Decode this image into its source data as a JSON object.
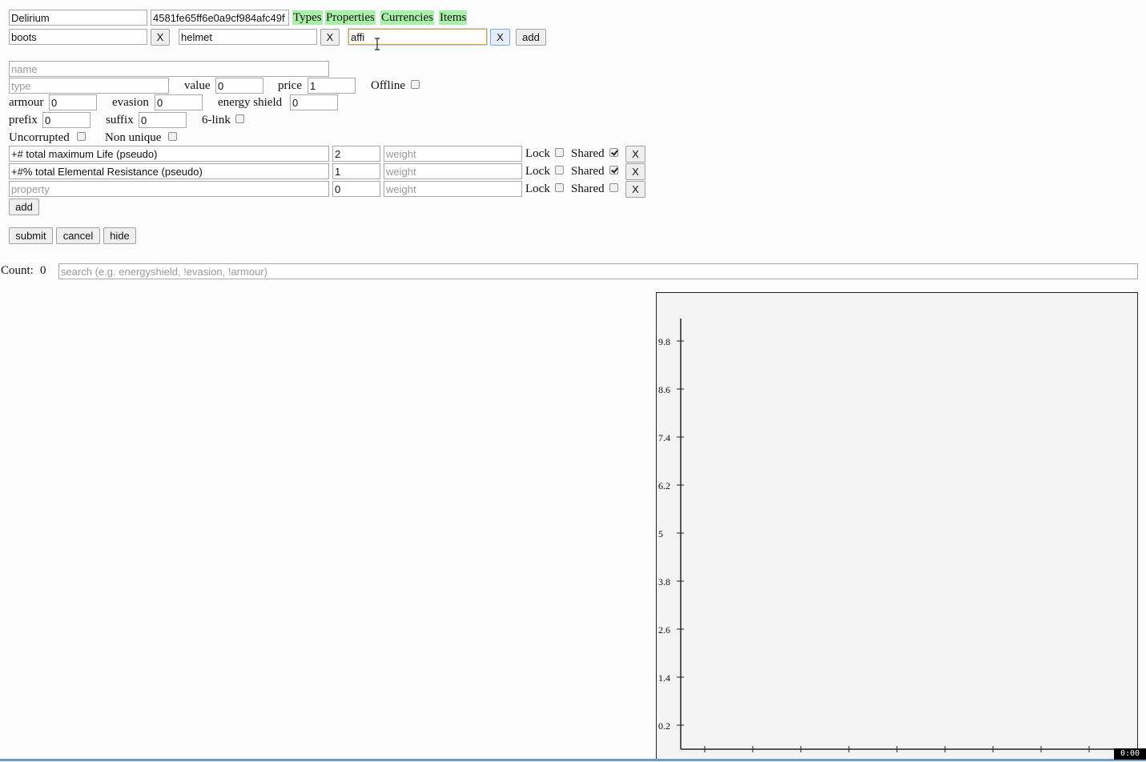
{
  "league": {
    "name_value": "Delirium",
    "id_value": "4581fe65ff6e0a9cf984afc49f"
  },
  "nav_links": [
    "Types",
    "Properties",
    "Currencies",
    "Items"
  ],
  "filters": [
    {
      "value": "boots",
      "remove_label": "X"
    },
    {
      "value": "helmet",
      "remove_label": "X"
    },
    {
      "value": "affi",
      "remove_label": "X"
    }
  ],
  "filter_add_label": "add",
  "form": {
    "name_placeholder": "name",
    "type_placeholder": "type",
    "value_label": "value",
    "value_value": "0",
    "price_label": "price",
    "price_value": "1",
    "offline_label": "Offline",
    "armour_label": "armour",
    "armour_value": "0",
    "evasion_label": "evasion",
    "evasion_value": "0",
    "energy_shield_label": "energy shield",
    "energy_shield_value": "0",
    "prefix_label": "prefix",
    "prefix_value": "0",
    "suffix_label": "suffix",
    "suffix_value": "0",
    "six_link_label": "6-link",
    "uncorrupted_label": "Uncorrupted",
    "non_unique_label": "Non unique"
  },
  "properties": [
    {
      "name": "+# total maximum Life (pseudo)",
      "weight_value": "2",
      "weight_placeholder": "weight",
      "lock": false,
      "shared": true
    },
    {
      "name": "+#% total Elemental Resistance (pseudo)",
      "weight_value": "1",
      "weight_placeholder": "weight",
      "lock": false,
      "shared": true
    },
    {
      "name": "",
      "placeholder": "property",
      "weight_value": "0",
      "weight_placeholder": "weight",
      "lock": false,
      "shared": false
    }
  ],
  "property_labels": {
    "lock": "Lock",
    "shared": "Shared",
    "remove": "X",
    "add": "add"
  },
  "actions": {
    "submit": "submit",
    "cancel": "cancel",
    "hide": "hide"
  },
  "results": {
    "count_label": "Count:",
    "count_value": "0",
    "search_placeholder": "search (e.g. energyshield, !evasion, !armour)"
  },
  "chart_data": {
    "type": "scatter",
    "y_ticks": [
      "9.8",
      "8.6",
      "7.4",
      "6.2",
      "5",
      "3.8",
      "2.6",
      "1.4",
      "0.2"
    ],
    "x_tick_count": 9,
    "series": []
  },
  "recording_timer": "0:00"
}
